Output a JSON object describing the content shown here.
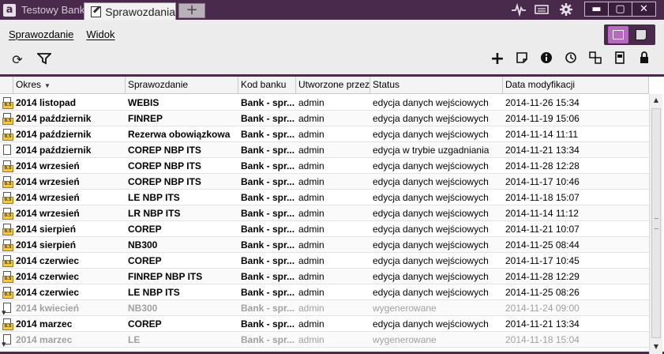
{
  "app": {
    "logo": "a",
    "name": "Testowy Bank",
    "active_tab": "Sprawozdania",
    "new_tab": "+"
  },
  "window_controls": {
    "minimize": "▬",
    "maximize": "▢",
    "close": "✕"
  },
  "menu": {
    "items": [
      "Sprawozdanie",
      "Widok"
    ]
  },
  "table": {
    "columns": [
      "Okres",
      "Sprawozdanie",
      "Kod banku",
      "Utworzone przez",
      "Status",
      "Data modyfikacji"
    ],
    "rows": [
      {
        "icon": "badge",
        "period": "2014 listopad",
        "report": "WEBIS",
        "bank": "Bank - spr...",
        "created": "admin",
        "status": "edycja danych wejściowych",
        "date": "2014-11-26 15:34"
      },
      {
        "icon": "badge",
        "period": "2014 październik",
        "report": "FINREP",
        "bank": "Bank - spr...",
        "created": "admin",
        "status": "edycja danych wejściowych",
        "date": "2014-11-19 15:06"
      },
      {
        "icon": "badge",
        "period": "2014 październik",
        "report": "Rezerwa obowiązkowa",
        "bank": "Bank - spr...",
        "created": "admin",
        "status": "edycja danych wejściowych",
        "date": "2014-11-14 11:11"
      },
      {
        "icon": "plain",
        "period": "2014 październik",
        "report": "COREP NBP ITS",
        "bank": "Bank - spr...",
        "created": "admin",
        "status": "edycja w trybie uzgadniania",
        "date": "2014-11-21 13:34"
      },
      {
        "icon": "badge",
        "period": "2014 wrzesień",
        "report": "COREP NBP ITS",
        "bank": "Bank - spr...",
        "created": "admin",
        "status": "edycja danych wejściowych",
        "date": "2014-11-28 12:28"
      },
      {
        "icon": "badge",
        "period": "2014 wrzesień",
        "report": "COREP NBP ITS",
        "bank": "Bank - spr...",
        "created": "admin",
        "status": "edycja danych wejściowych",
        "date": "2014-11-17 10:46"
      },
      {
        "icon": "badge",
        "period": "2014 wrzesień",
        "report": "LE NBP ITS",
        "bank": "Bank - spr...",
        "created": "admin",
        "status": "edycja danych wejściowych",
        "date": "2014-11-18 15:07"
      },
      {
        "icon": "badge",
        "period": "2014 wrzesień",
        "report": "LR NBP ITS",
        "bank": "Bank - spr...",
        "created": "admin",
        "status": "edycja danych wejściowych",
        "date": "2014-11-14 11:12"
      },
      {
        "icon": "badge",
        "period": "2014 sierpień",
        "report": "COREP",
        "bank": "Bank - spr...",
        "created": "admin",
        "status": "edycja danych wejściowych",
        "date": "2014-11-21 10:07"
      },
      {
        "icon": "badge",
        "period": "2014 sierpień",
        "report": "NB300",
        "bank": "Bank - spr...",
        "created": "admin",
        "status": "edycja danych wejściowych",
        "date": "2014-11-25 08:44"
      },
      {
        "icon": "badge",
        "period": "2014 czerwiec",
        "report": "COREP",
        "bank": "Bank - spr...",
        "created": "admin",
        "status": "edycja danych wejściowych",
        "date": "2014-11-17 10:45"
      },
      {
        "icon": "badge",
        "period": "2014 czerwiec",
        "report": "FINREP NBP ITS",
        "bank": "Bank - spr...",
        "created": "admin",
        "status": "edycja danych wejściowych",
        "date": "2014-11-28 12:29"
      },
      {
        "icon": "badge",
        "period": "2014 czerwiec",
        "report": "LE NBP ITS",
        "bank": "Bank - spr...",
        "created": "admin",
        "status": "edycja danych wejściowych",
        "date": "2014-11-25 08:26"
      },
      {
        "icon": "down",
        "muted": true,
        "period": "2014 kwiecień",
        "report": "NB300",
        "bank": "Bank - spr...",
        "created": "admin",
        "status": "wygenerowane",
        "date": "2014-11-24 09:00"
      },
      {
        "icon": "badge",
        "period": "2014 marzec",
        "report": "COREP",
        "bank": "Bank - spr...",
        "created": "admin",
        "status": "edycja danych wejściowych",
        "date": "2014-11-21 13:34"
      },
      {
        "icon": "down",
        "muted": true,
        "period": "2014 marzec",
        "report": "LE",
        "bank": "Bank - spr...",
        "created": "admin",
        "status": "wygenerowane",
        "date": "2014-11-18 15:04"
      }
    ]
  }
}
